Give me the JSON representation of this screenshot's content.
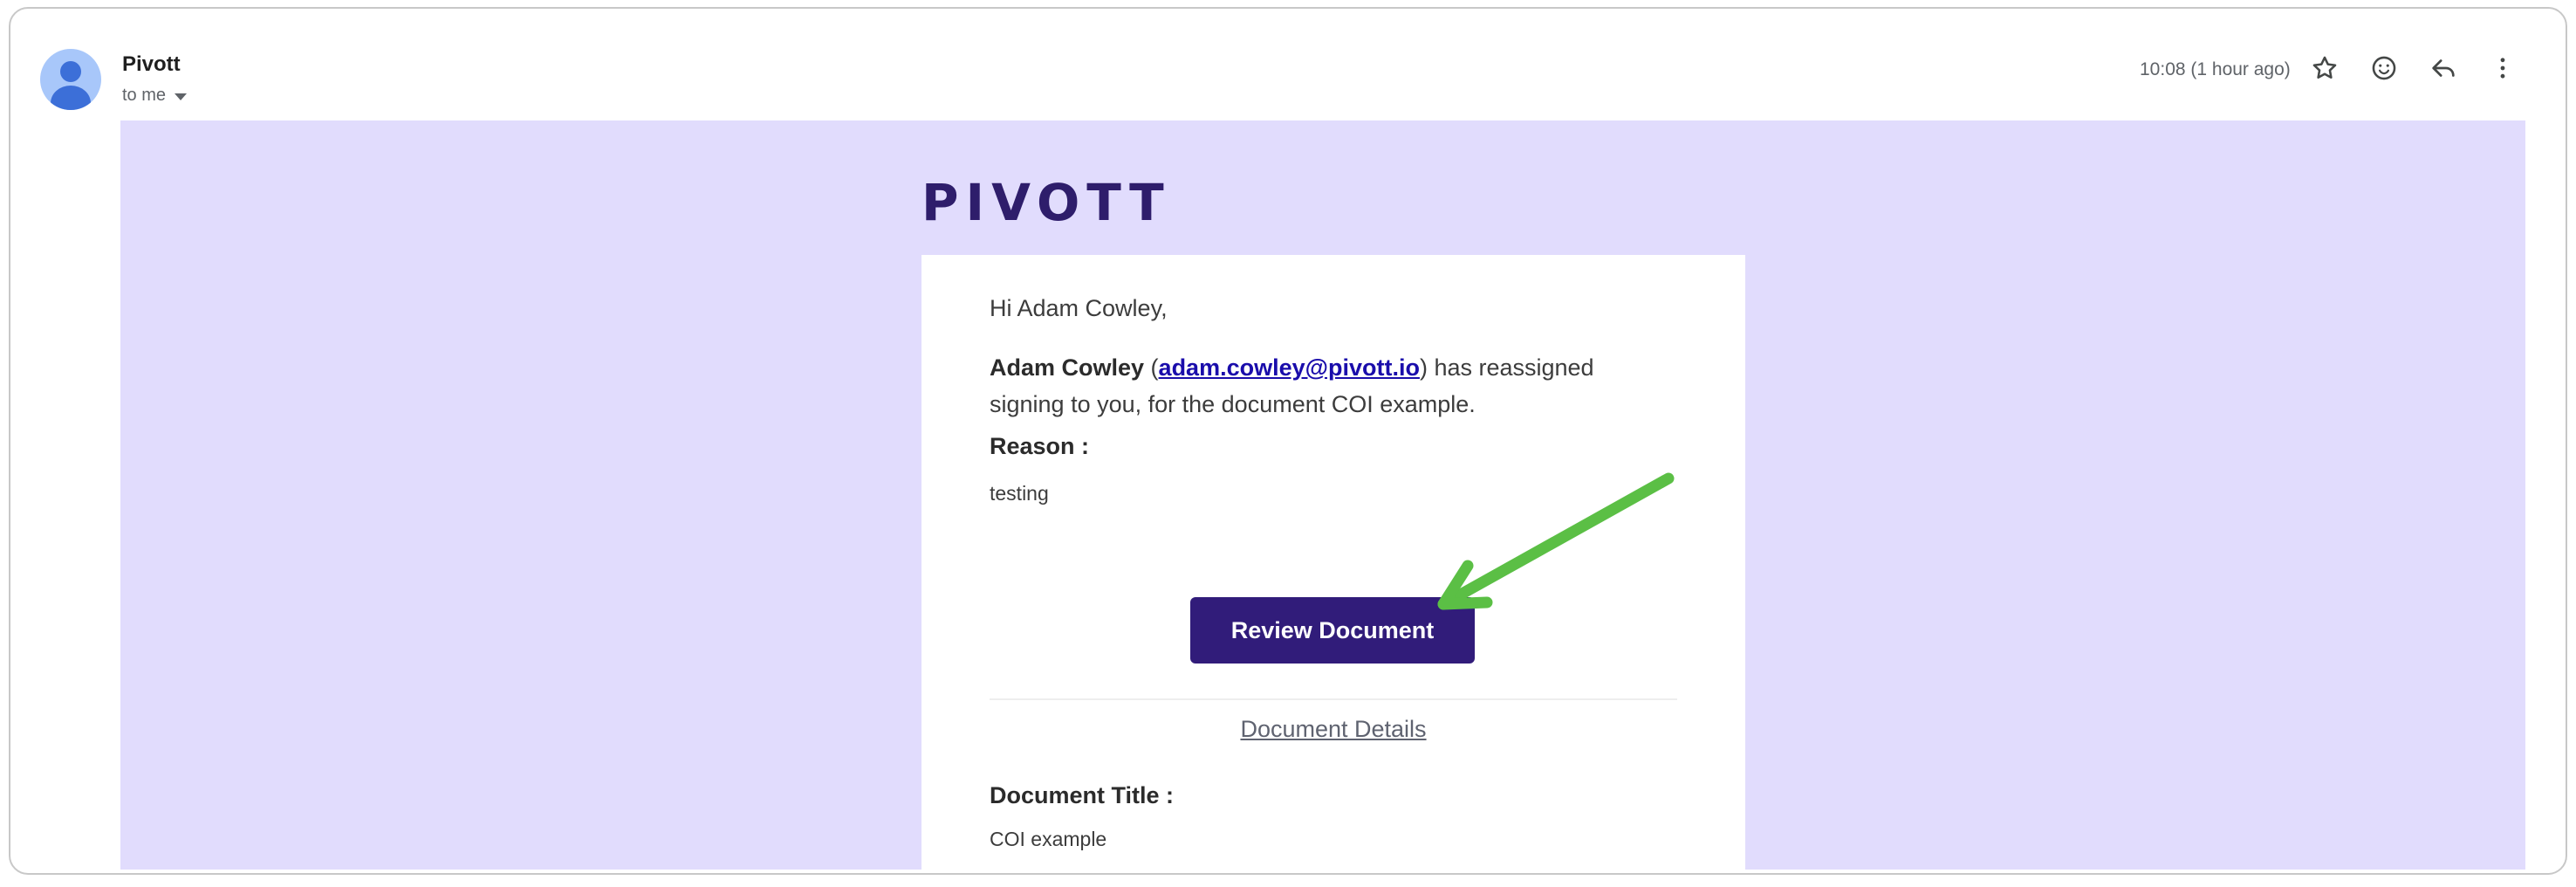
{
  "header": {
    "sender": "Pivott",
    "recipient": "to me",
    "timestamp": "10:08 (1 hour ago)",
    "icons": [
      "star-icon",
      "emoji-icon",
      "reply-icon",
      "more-vert-icon"
    ]
  },
  "email": {
    "logo": "PIVOTT",
    "greeting": "Hi Adam Cowley,",
    "body_name": "Adam Cowley",
    "body_email": "adam.cowley@pivott.io",
    "body_rest": "has reassigned signing to you, for the document COI example.",
    "reason_label": "Reason :",
    "reason_value": "testing",
    "cta_label": "Review Document",
    "details_link": "Document Details",
    "doc_title_label": "Document Title :",
    "doc_title_value": "COI example"
  },
  "colors": {
    "banner_bg": "#e1dcfd",
    "button_bg": "#311c7a",
    "logo": "#2e1d6b",
    "link": "#1a0dab",
    "annotation_arrow": "#5bbf45"
  }
}
